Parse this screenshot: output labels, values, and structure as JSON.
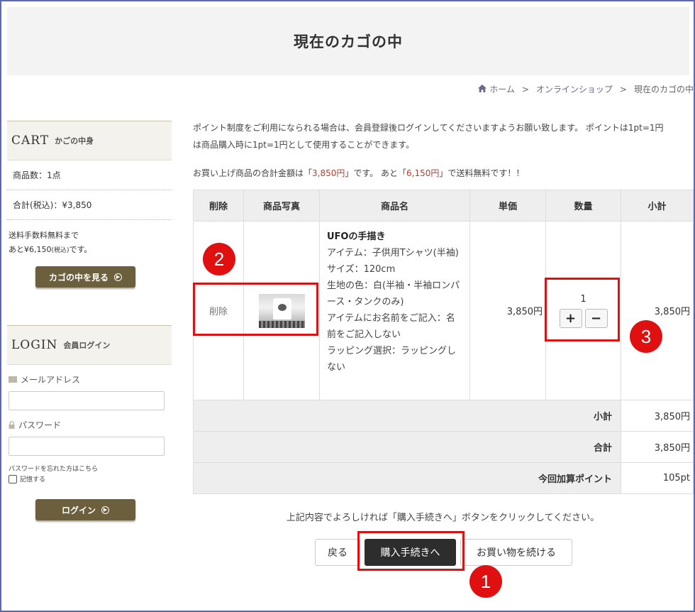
{
  "page": {
    "title": "現在のカゴの中"
  },
  "breadcrumb": {
    "home": "ホーム",
    "sep1": ">",
    "shop": "オンラインショップ",
    "sep2": ">",
    "current": "現在のカゴの中"
  },
  "sidebar": {
    "cart": {
      "title_en": "CART",
      "title_jp": "かごの中身",
      "count": "商品数：1点",
      "total": "合計(税込)：¥3,850",
      "ship_line1": "送料手数料無料まで",
      "ship_line2_prefix": "あと¥6,150",
      "ship_line2_small": "(税込)",
      "ship_line2_suffix": "です。",
      "button": "カゴの中を見る"
    },
    "login": {
      "title_en": "LOGIN",
      "title_jp": "会員ログイン",
      "email_label": "メールアドレス",
      "password_label": "パスワード",
      "forgot": "パスワードを忘れた方はこちら",
      "remember": "記憶する",
      "button": "ログイン"
    }
  },
  "notice": {
    "line1": "ポイント制度をご利用になられる場合は、会員登録後ログインしてくださいますようお願い致します。 ポイントは1pt=1円",
    "line2": "は商品購入時に1pt=1円として使用することができます。",
    "total_prefix": "お買い上げ商品の合計金額は「",
    "total_amount": "3,850円",
    "total_mid": "」です。 あと「",
    "remain_amount": "6,150円",
    "total_suffix": "」で送料無料です！！"
  },
  "table": {
    "headers": [
      "削除",
      "商品写真",
      "商品名",
      "単価",
      "数量",
      "小計"
    ],
    "item": {
      "delete": "削除",
      "name": "UFOの手描き",
      "attrs": [
        "アイテム：子供用Tシャツ(半袖)",
        "サイズ：120cm",
        "生地の色：白(半袖・半袖ロンパース・タンクのみ)",
        "アイテムにお名前をご記入：名前をご記入しない",
        "ラッピング選択：ラッピングしない"
      ],
      "unit_price": "3,850円",
      "quantity": "1",
      "plus": "+",
      "minus": "−",
      "subtotal": "3,850円"
    },
    "summary": [
      {
        "label": "小計",
        "value": "3,850円"
      },
      {
        "label": "合計",
        "value": "3,850円"
      },
      {
        "label": "今回加算ポイント",
        "value": "105pt"
      }
    ]
  },
  "confirm_text": "上記内容でよろしければ「購入手続きへ」ボタンをクリックしてください。",
  "buttons": {
    "back": "戻る",
    "checkout": "購入手続きへ",
    "continue": "お買い物を続ける"
  },
  "annotations": {
    "n1": "1",
    "n2": "2",
    "n3": "3",
    "color": "#e01010"
  }
}
